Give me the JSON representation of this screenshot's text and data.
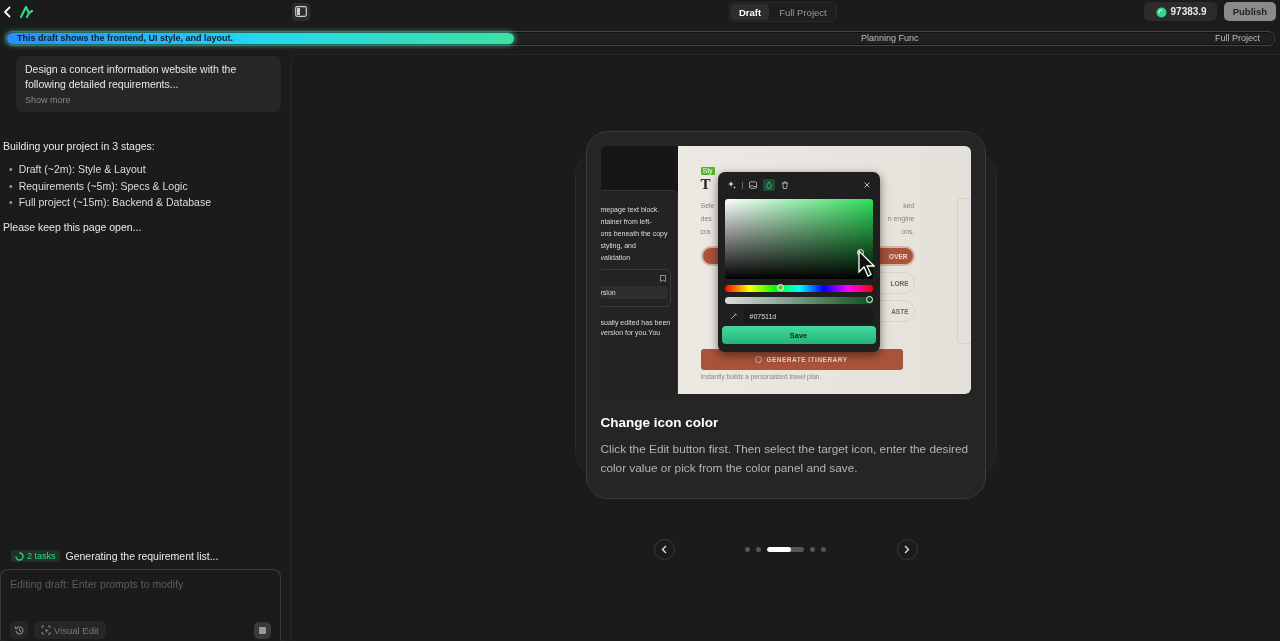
{
  "top_bar": {
    "mode_tabs": [
      {
        "label": "Draft",
        "selected": true
      },
      {
        "label": "Full Project",
        "selected": false
      }
    ],
    "credits": "97383.9",
    "publish": "Publish"
  },
  "progress": {
    "level": 0.4,
    "message": "This draft shows the frontend, UI style, and layout.",
    "stages": [
      "Planning Func",
      "Full Project"
    ]
  },
  "chat": {
    "prompt": "Design a concert information website with the following detailed requirements...",
    "show_more": "Show more",
    "intro": "Building your project in 3 stages:",
    "stages": [
      {
        "bullet": "•",
        "text": "Draft (~2m): Style & Layout"
      },
      {
        "bullet": "•",
        "text": "Requirements (~5m): Specs & Logic"
      },
      {
        "bullet": "•",
        "text": "Full project (~15m): Backend & Database"
      }
    ],
    "note": "Please keep this page open...",
    "tasks_badge": "2 tasks",
    "task_status": "Generating the requirement list...",
    "input": {
      "placeholder": "Editing draft: Enter prompts to modify"
    },
    "visual_edit": "Visual Edit"
  },
  "tutorial": {
    "screenshot": {
      "side_lines": [
        "mepage text block.",
        "ntainer from left-",
        "ons beneath the copy",
        "styling, and",
        "validation"
      ],
      "side_item": "rsion",
      "side_footer": "sually edited has been version for you.You",
      "page": {
        "tag": "Sty",
        "title": "T",
        "text_left": [
          "Sele",
          "des",
          "cra"
        ],
        "text_right": [
          "ked",
          "n engine",
          "ons."
        ],
        "chips": [
          "OVER",
          "LORE",
          "ASTE"
        ],
        "generate": "GENERATE ITINERARY",
        "caption": "Instantly builds a personalized travel plan."
      },
      "popup": {
        "tools": [
          {
            "kind": "sparkle",
            "selected": false
          },
          {
            "kind": "image",
            "selected": false
          },
          {
            "kind": "drop",
            "selected": true
          },
          {
            "kind": "trash",
            "selected": false
          }
        ],
        "hue": {
          "level": 0.38
        },
        "alpha": {
          "level": 0.98
        },
        "hex": "#07511d",
        "save": "Save"
      }
    },
    "title": "Change icon color",
    "description": "Click the Edit button first. Then select the target icon, enter the desired color value or pick from the color panel and save."
  },
  "carousel": {
    "dots": [
      {
        "selected": false
      },
      {
        "selected": false
      },
      {
        "selected": true,
        "level": 0.65
      },
      {
        "selected": false
      },
      {
        "selected": false
      }
    ]
  }
}
